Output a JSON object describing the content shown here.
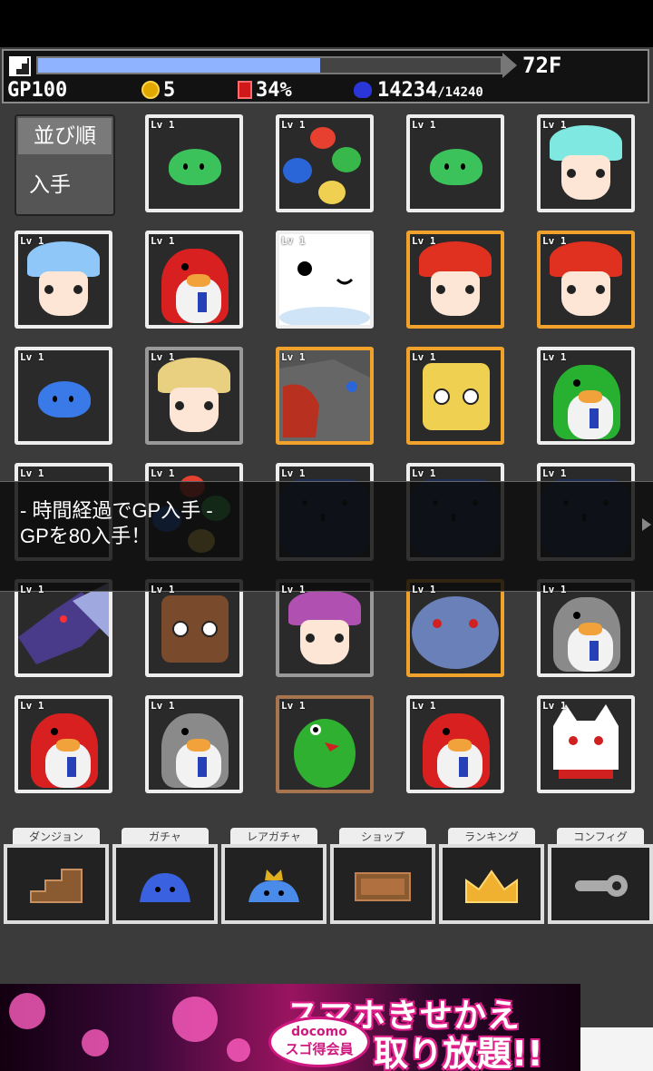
{
  "status": {
    "floor": "72F",
    "progress_fraction": 0.61,
    "gp": "GP100",
    "coins": "5",
    "book": "34%",
    "monsters_count": "14234",
    "monsters_total": "/14240"
  },
  "sort_panel": {
    "title": "並び順",
    "value": "入手"
  },
  "cards": [
    {
      "lv": "Lv 1",
      "art": "green-slime",
      "frame": "white"
    },
    {
      "lv": "Lv 1",
      "art": "color-slimes",
      "frame": "white"
    },
    {
      "lv": "Lv 1",
      "art": "green-slime",
      "frame": "white"
    },
    {
      "lv": "Lv 1",
      "art": "cyan-girl",
      "frame": "white"
    },
    {
      "lv": "Lv 1",
      "art": "blue-girl",
      "frame": "white"
    },
    {
      "lv": "Lv 1",
      "art": "red-bird",
      "frame": "white"
    },
    {
      "lv": "Lv 1",
      "art": "white-blob",
      "frame": "white"
    },
    {
      "lv": "Lv 1",
      "art": "red-hair",
      "frame": "gold"
    },
    {
      "lv": "Lv 1",
      "art": "red-hair",
      "frame": "gold"
    },
    {
      "lv": "Lv 1",
      "art": "blue-slime",
      "frame": "white"
    },
    {
      "lv": "Lv 1",
      "art": "elf",
      "frame": "gray"
    },
    {
      "lv": "Lv 1",
      "art": "dragon-head",
      "frame": "gold"
    },
    {
      "lv": "Lv 1",
      "art": "yellow-box",
      "frame": "gold"
    },
    {
      "lv": "Lv 1",
      "art": "green-bird",
      "frame": "white"
    },
    {
      "lv": "Lv 1",
      "art": "blank",
      "frame": "white"
    },
    {
      "lv": "Lv 1",
      "art": "color-slimes",
      "frame": "white"
    },
    {
      "lv": "Lv 1",
      "art": "navy-blob",
      "frame": "white"
    },
    {
      "lv": "Lv 1",
      "art": "navy-blob",
      "frame": "white"
    },
    {
      "lv": "Lv 1",
      "art": "navy-blob",
      "frame": "white"
    },
    {
      "lv": "Lv 1",
      "art": "purple-dragon",
      "frame": "white"
    },
    {
      "lv": "Lv 1",
      "art": "brown-box",
      "frame": "white"
    },
    {
      "lv": "Lv 1",
      "art": "pink-girl",
      "frame": "gray"
    },
    {
      "lv": "Lv 1",
      "art": "blue-dragon",
      "frame": "gold"
    },
    {
      "lv": "Lv 1",
      "art": "gray-bird",
      "frame": "white"
    },
    {
      "lv": "Lv 1",
      "art": "red-bird",
      "frame": "white"
    },
    {
      "lv": "Lv 1",
      "art": "gray-bird",
      "frame": "white"
    },
    {
      "lv": "Lv 1",
      "art": "green-dino",
      "frame": "bronze"
    },
    {
      "lv": "Lv 1",
      "art": "red-bird",
      "frame": "white"
    },
    {
      "lv": "Lv 1",
      "art": "white-cat",
      "frame": "white"
    }
  ],
  "toast": {
    "line1": "- 時間経過でGP入手 -",
    "line2": "GPを80入手！"
  },
  "menu": [
    {
      "label": "ダンジョン",
      "icon": "stairs-icon"
    },
    {
      "label": "ガチャ",
      "icon": "slime-icon"
    },
    {
      "label": "レアガチャ",
      "icon": "crowned-slime-icon"
    },
    {
      "label": "ショップ",
      "icon": "open-sign-icon"
    },
    {
      "label": "ランキング",
      "icon": "crown-icon"
    },
    {
      "label": "コンフィグ",
      "icon": "wrench-icon"
    }
  ],
  "ad": {
    "title": "スマホきせかえ",
    "subtitle": "取り放題!!",
    "badge_line1": "docomo",
    "badge_line2": "スゴ得会員"
  }
}
